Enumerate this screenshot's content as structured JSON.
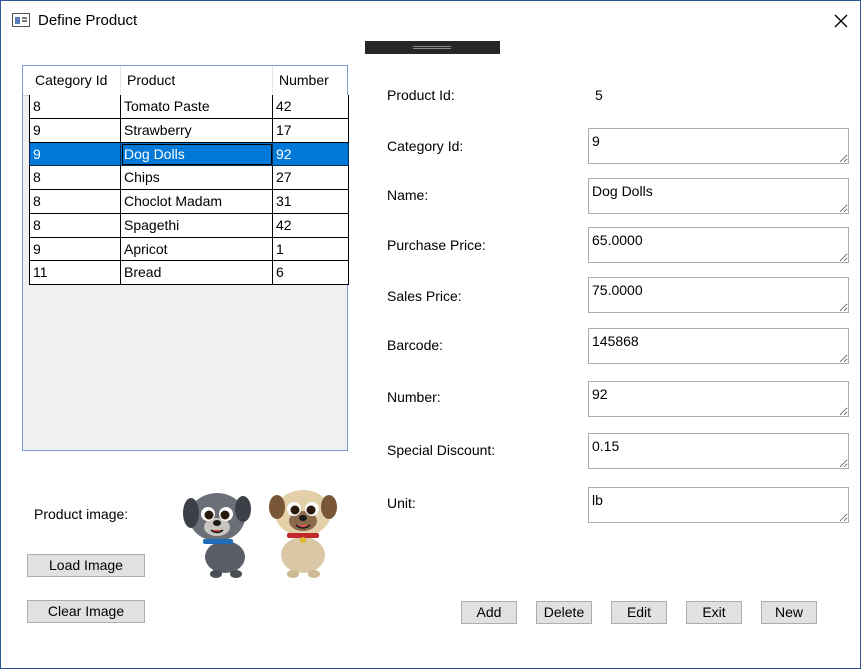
{
  "window": {
    "title": "Define Product"
  },
  "grid": {
    "columns": [
      "Category Id",
      "Product",
      "Number"
    ],
    "rows": [
      [
        "8",
        "Tomato Paste",
        "42"
      ],
      [
        "9",
        "Strawberry",
        "17"
      ],
      [
        "9",
        "Dog Dolls",
        "92"
      ],
      [
        "8",
        "Chips",
        "27"
      ],
      [
        "8",
        "Choclot Madam",
        "31"
      ],
      [
        "8",
        "Spagethi",
        "42"
      ],
      [
        "9",
        "Apricot",
        "1"
      ],
      [
        "11",
        "Bread",
        "6"
      ]
    ],
    "selected_index": 2
  },
  "image_panel": {
    "label": "Product image:",
    "load_button": "Load Image",
    "clear_button": "Clear Image"
  },
  "form": {
    "product_id_label": "Product Id:",
    "product_id_value": "5",
    "category_id_label": "Category Id:",
    "category_id_value": "9",
    "name_label": "Name:",
    "name_value": "Dog Dolls",
    "purchase_price_label": "Purchase Price:",
    "purchase_price_value": "65.0000",
    "sales_price_label": "Sales Price:",
    "sales_price_value": "75.0000",
    "barcode_label": "Barcode:",
    "barcode_value": "145868",
    "number_label": "Number:",
    "number_value": "92",
    "special_discount_label": "Special Discount:",
    "special_discount_value": "0.15",
    "unit_label": "Unit:",
    "unit_value": "lb"
  },
  "actions": {
    "add": "Add",
    "delete": "Delete",
    "edit": "Edit",
    "exit": "Exit",
    "new": "New"
  },
  "colors": {
    "selection": "#0078d7",
    "grid_border": "#7a9cd3",
    "button_face": "#e1e1e1"
  }
}
